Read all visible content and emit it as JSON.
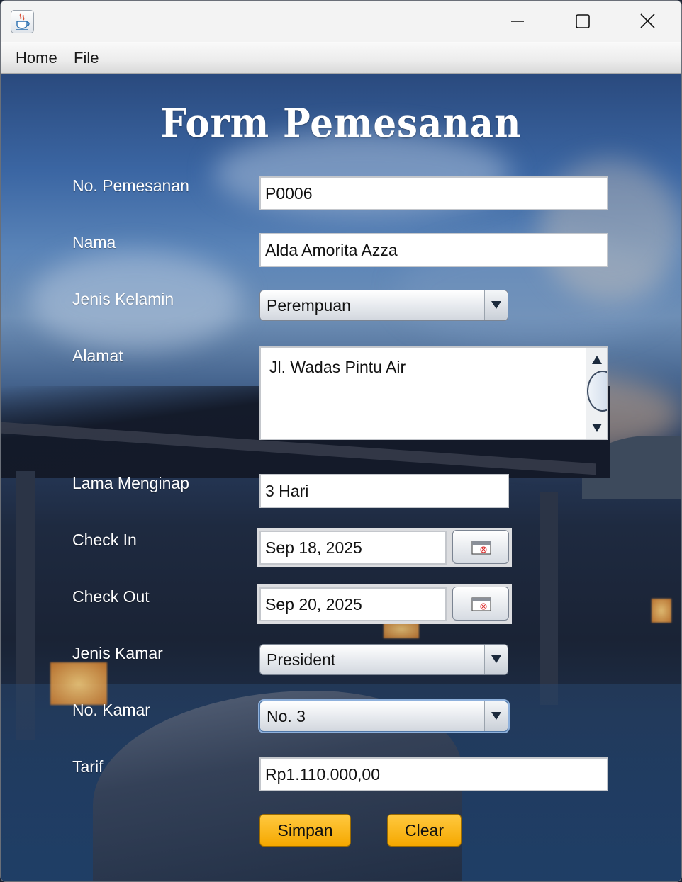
{
  "window": {
    "icon": "java-coffee-icon",
    "controls": {
      "minimize": "minimize-icon",
      "maximize": "maximize-icon",
      "close": "close-icon"
    }
  },
  "menu": {
    "home": "Home",
    "file": "File"
  },
  "form": {
    "title": "Form Pemesanan",
    "no_pemesanan": {
      "label": "No. Pemesanan",
      "value": "P0006"
    },
    "nama": {
      "label": "Nama",
      "value": "Alda Amorita Azza"
    },
    "jenis_kelamin": {
      "label": "Jenis Kelamin",
      "value": "Perempuan"
    },
    "alamat": {
      "label": "Alamat",
      "value": "Jl. Wadas Pintu Air"
    },
    "lama_menginap": {
      "label": "Lama Menginap",
      "value": "3 Hari"
    },
    "check_in": {
      "label": "Check In",
      "value": "Sep 18, 2025"
    },
    "check_out": {
      "label": "Check Out",
      "value": "Sep 20, 2025"
    },
    "jenis_kamar": {
      "label": "Jenis Kamar",
      "value": "President"
    },
    "no_kamar": {
      "label": "No. Kamar",
      "value": "No. 3"
    },
    "tarif": {
      "label": "Tarif",
      "value": "Rp1.110.000,00"
    },
    "buttons": {
      "simpan": "Simpan",
      "clear": "Clear"
    }
  },
  "colors": {
    "button_accent": "#f5a800",
    "title_text": "#ffffff"
  }
}
